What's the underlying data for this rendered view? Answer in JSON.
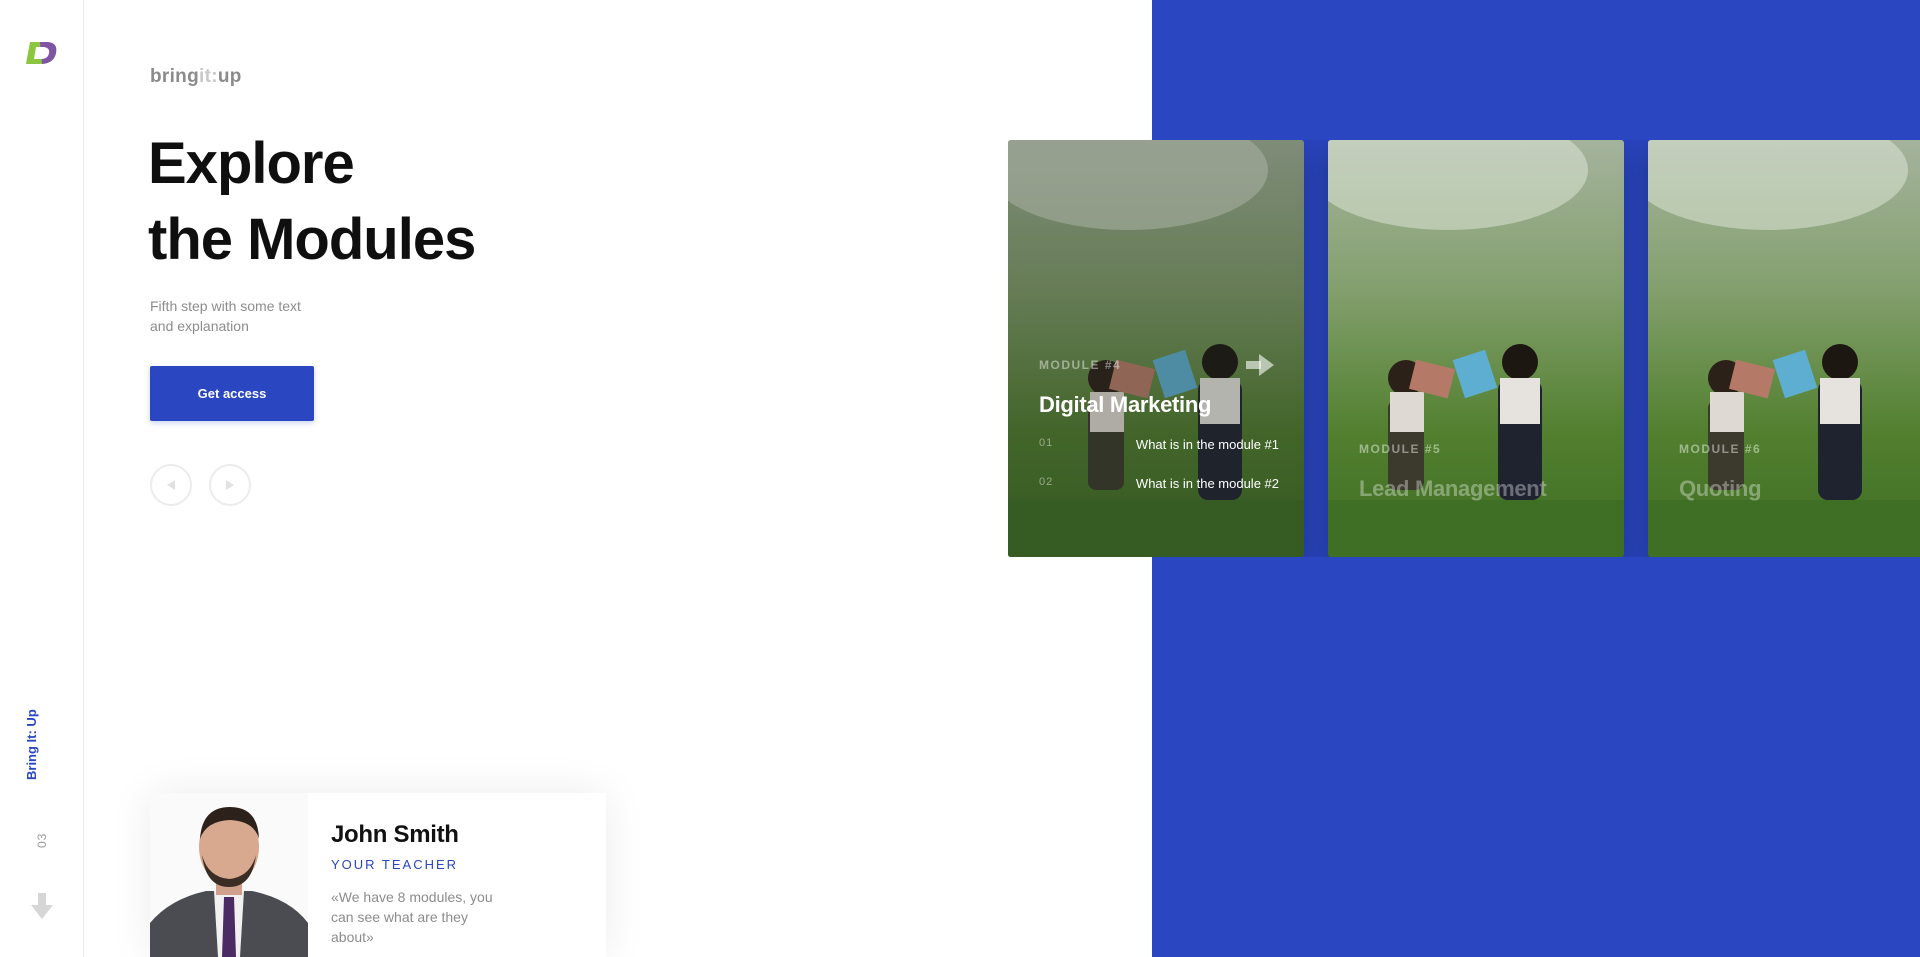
{
  "sidebar": {
    "brand_vertical": "Bring It: Up",
    "page_number": "03"
  },
  "header": {
    "wordmark_part1": "bring",
    "wordmark_part2": "it:",
    "wordmark_part3": "up"
  },
  "hero": {
    "title_line1": "Explore",
    "title_line2": "the Modules",
    "subtitle_line1": "Fifth step with some text",
    "subtitle_line2": "and explanation",
    "cta_label": "Get access"
  },
  "cards": [
    {
      "label": "MODULE #4",
      "title": "Digital Marketing",
      "items": [
        {
          "num": "01",
          "text": "What is in the module #1"
        },
        {
          "num": "02",
          "text": "What is in the module #2"
        }
      ]
    },
    {
      "label": "MODULE #5",
      "title": "Lead Management"
    },
    {
      "label": "MODULE #6",
      "title": "Quoting"
    }
  ],
  "teacher": {
    "name": "John Smith",
    "role": "YOUR TEACHER",
    "quote": "«We have 8 modules, you can see what are they about»"
  },
  "colors": {
    "accent": "#2a46c0",
    "logo_green": "#8cc63f",
    "logo_purple": "#7b3fb5"
  },
  "icons": {
    "logo": "brand-logo-icon",
    "down": "arrow-down-icon",
    "prev": "play-left-icon",
    "next": "play-right-icon",
    "card_arrow": "arrow-right-icon"
  }
}
